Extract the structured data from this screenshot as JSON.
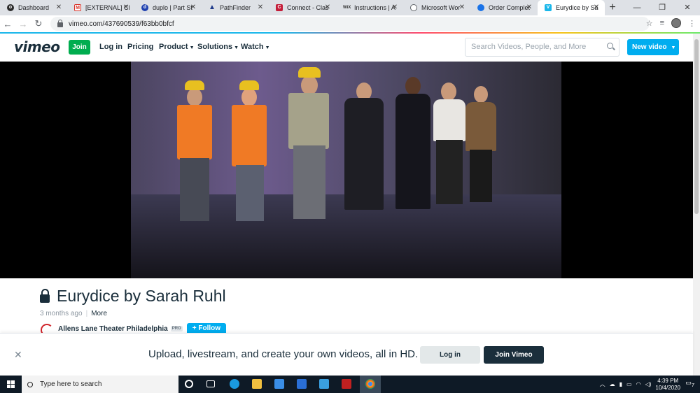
{
  "browser": {
    "tabs": [
      {
        "title": "Dashboard",
        "favicon_color": "#2b2b2b"
      },
      {
        "title": "[EXTERNAL] Cl",
        "favicon_color": "#d93025"
      },
      {
        "title": "duplo | Part St",
        "favicon_color": "#1e40af"
      },
      {
        "title": "PathFinder",
        "favicon_color": "#1e3a8a"
      },
      {
        "title": "Connect - Clas",
        "favicon_color": "#c41e3a"
      },
      {
        "title": "Instructions | A",
        "favicon_color": "#333333"
      },
      {
        "title": "Microsoft Wor",
        "favicon_color": "#5f6368"
      },
      {
        "title": "Order Complet",
        "favicon_color": "#1a73e8"
      },
      {
        "title": "Eurydice by Sa",
        "favicon_color": "#1ab7ea",
        "active": true
      }
    ],
    "url": "vimeo.com/437690539/f63bb0bfcf"
  },
  "vimeo_nav": {
    "logo": "vimeo",
    "join": "Join",
    "login": "Log in",
    "pricing": "Pricing",
    "product": "Product",
    "solutions": "Solutions",
    "watch": "Watch",
    "search_placeholder": "Search Videos, People, and More",
    "new_video": "New video"
  },
  "video": {
    "title": "Eurydice by Sarah Ruhl",
    "age": "3 months ago",
    "more": "More",
    "owner": "Allens Lane Theater Philadelphia",
    "owner_badge": "PRO",
    "follow": "+ Follow"
  },
  "banner": {
    "message": "Upload, livestream, and create your own videos, all in HD.",
    "login": "Log in",
    "join": "Join Vimeo"
  },
  "taskbar": {
    "search_placeholder": "Type here to search",
    "time": "4:39 PM",
    "date": "10/4/2020",
    "notifications": "7"
  }
}
